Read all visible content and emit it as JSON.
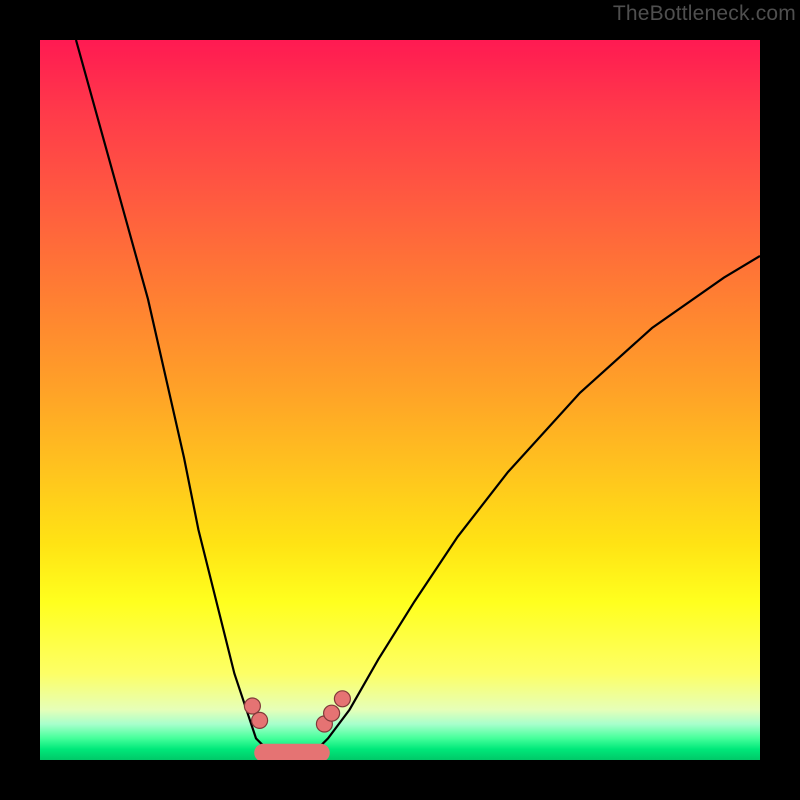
{
  "watermark": "TheBottleneck.com",
  "chart_data": {
    "type": "line",
    "title": "",
    "xlabel": "",
    "ylabel": "",
    "xlim": [
      0,
      100
    ],
    "ylim": [
      0,
      100
    ],
    "grid": false,
    "legend": false,
    "gradient": {
      "top": "#ff1a52",
      "mid": "#ffe314",
      "bottom": "#00c868",
      "meaning_top": "high-bottleneck",
      "meaning_bottom": "no-bottleneck"
    },
    "series": [
      {
        "name": "left-curve",
        "x": [
          5,
          10,
          15,
          20,
          22,
          25,
          27,
          29,
          30,
          32,
          34
        ],
        "y": [
          100,
          82,
          64,
          42,
          32,
          20,
          12,
          6,
          3,
          1,
          0.5
        ]
      },
      {
        "name": "right-curve",
        "x": [
          38,
          40,
          43,
          47,
          52,
          58,
          65,
          75,
          85,
          95,
          100
        ],
        "y": [
          1,
          3,
          7,
          14,
          22,
          31,
          40,
          51,
          60,
          67,
          70
        ]
      }
    ],
    "markers": [
      {
        "series": "left-curve",
        "x": 29.5,
        "y": 7.5
      },
      {
        "series": "left-curve",
        "x": 30.5,
        "y": 5.5
      },
      {
        "series": "right-curve",
        "x": 39.5,
        "y": 5.0
      },
      {
        "series": "right-curve",
        "x": 40.5,
        "y": 6.5
      },
      {
        "series": "right-curve",
        "x": 42.0,
        "y": 8.5
      }
    ],
    "optimal_band": {
      "x_start": 31,
      "x_end": 39,
      "y": 1.0
    }
  }
}
